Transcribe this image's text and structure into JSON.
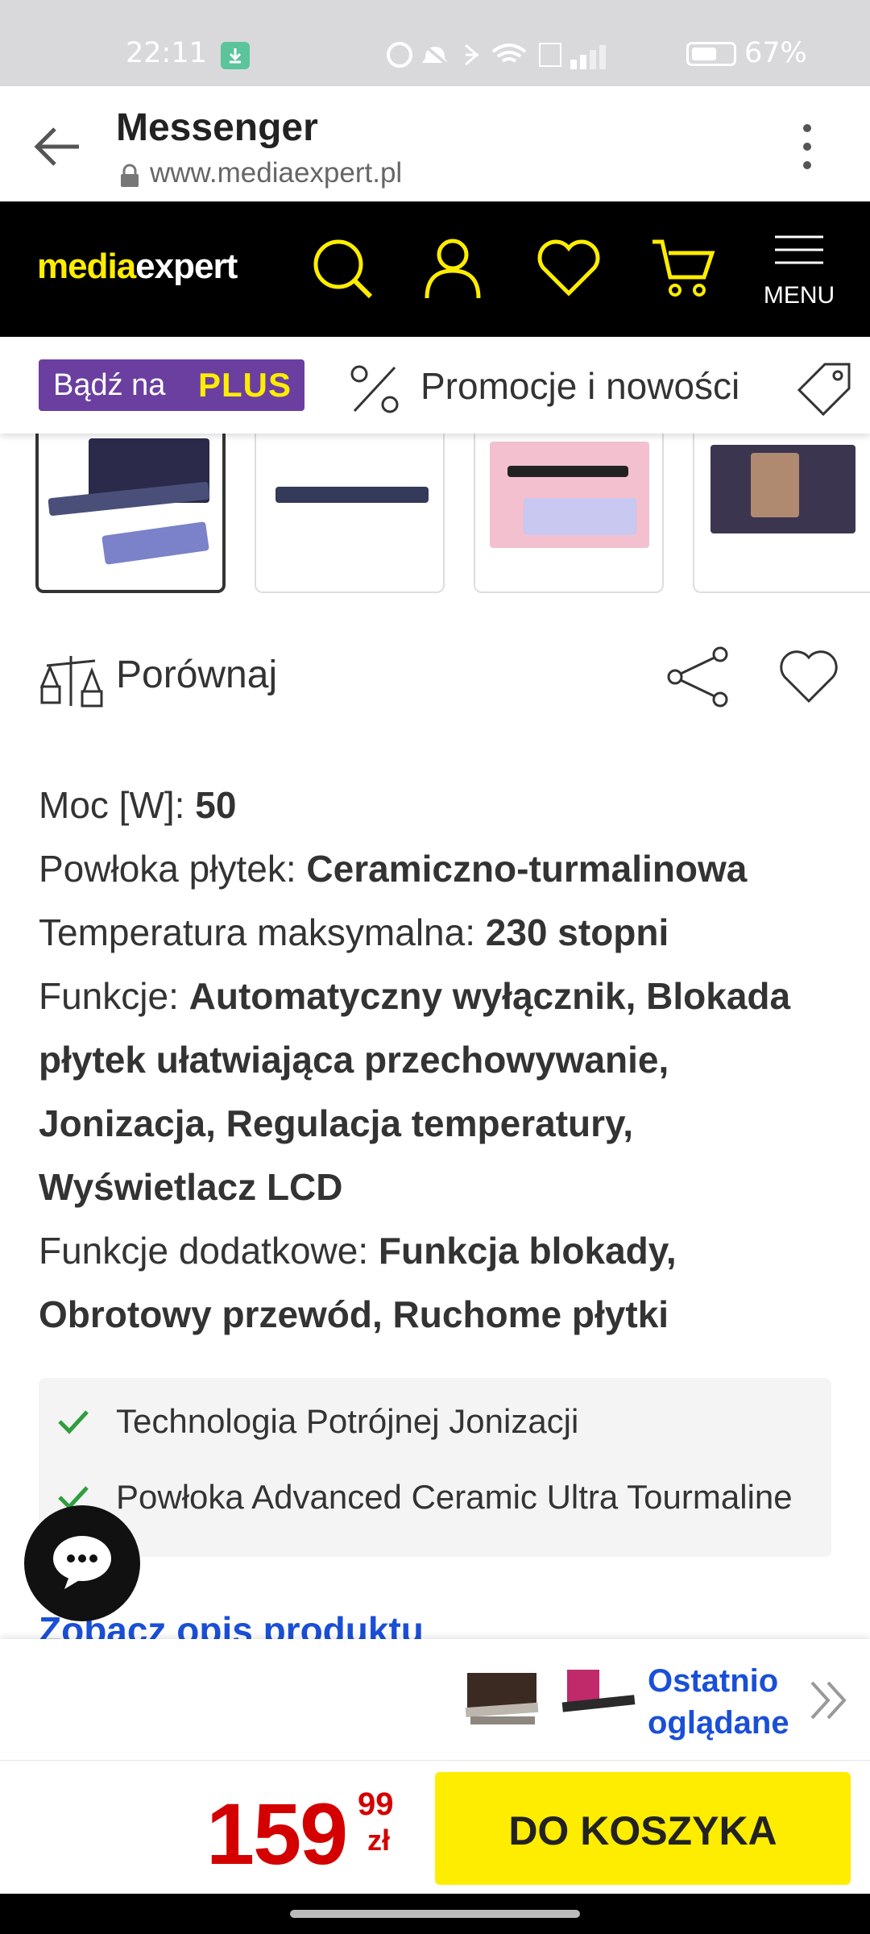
{
  "status_bar": {
    "time": "22:11",
    "battery": "67%"
  },
  "browser": {
    "title": "Messenger",
    "url": "www.mediaexpert.pl"
  },
  "site_header": {
    "logo_part1": "media",
    "logo_part2": "expert",
    "menu_label": "MENU",
    "icons": [
      "search-icon",
      "account-icon",
      "wishlist-icon",
      "cart-icon",
      "hamburger-icon"
    ]
  },
  "promo_bar": {
    "plus_text": "Bądź na",
    "plus_word": "PLUS",
    "promo_label": "Promocje i nowości"
  },
  "actions": {
    "compare_label": "Porównaj"
  },
  "specs": [
    {
      "label": "Moc [W]: ",
      "value": "50"
    },
    {
      "label": "Powłoka płytek: ",
      "value": "Ceramiczno-turmalinowa"
    },
    {
      "label": "Temperatura maksymalna: ",
      "value": "230 stopni"
    },
    {
      "label": "Funkcje: ",
      "value": "Automatyczny wyłącznik, Blokada płytek ułatwiająca przechowywanie, Jonizacja, Regulacja temperatury, Wyświetlacz LCD"
    },
    {
      "label": "Funkcje dodatkowe: ",
      "value": "Funkcja blokady, Obrotowy przewód, Ruchome płytki"
    }
  ],
  "features": [
    "Technologia Potrójnej Jonizacji",
    "Powłoka Advanced Ceramic Ultra Tourmaline"
  ],
  "description_link": "Zobacz opis produktu",
  "recently_viewed": {
    "line1": "Ostatnio",
    "line2": "oglądane"
  },
  "price": {
    "main": "159",
    "cents": "99",
    "currency": "zł"
  },
  "buy_button": "DO KOSZYKA",
  "colors": {
    "brand_yellow": "#ffed00",
    "plus_purple": "#6b3fa0",
    "price_red": "#d40000",
    "link_blue": "#1a4fd6"
  }
}
